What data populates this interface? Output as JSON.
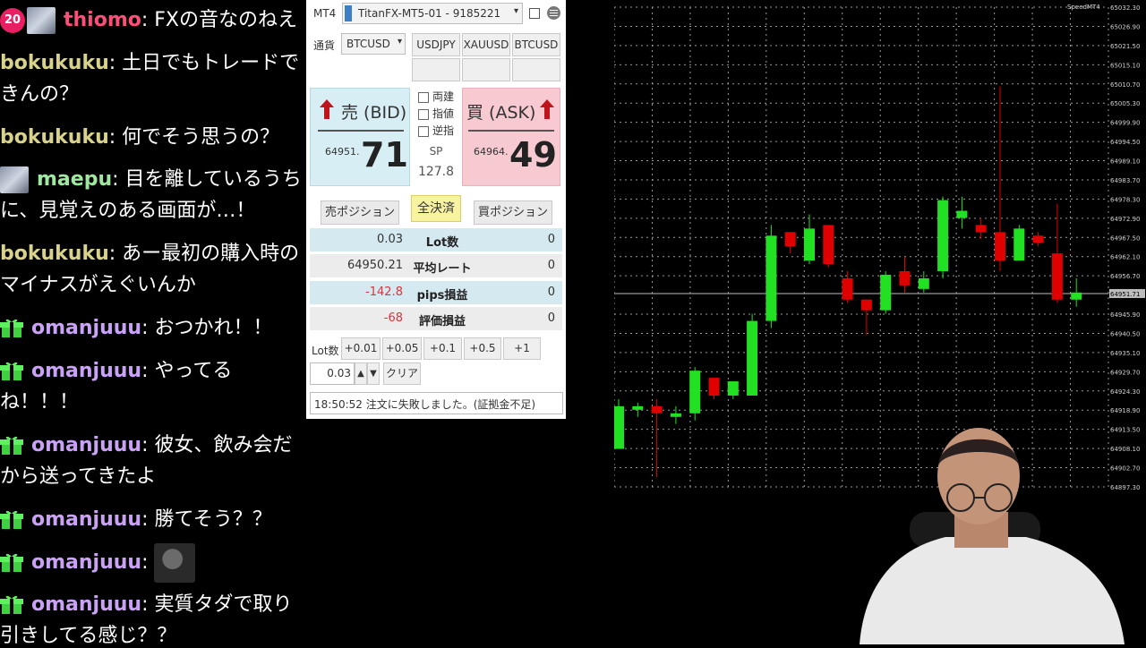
{
  "chat": {
    "messages": [
      {
        "badge": "sub",
        "badge_text": "20",
        "avatar": true,
        "user": "thiomo",
        "user_color": "#ff4d7a",
        "text": "FXの音なのねえ"
      },
      {
        "user": "bokukuku",
        "user_color": "#d8d28a",
        "text": "土日でもトレードできんの？"
      },
      {
        "user": "bokukuku",
        "user_color": "#d8d28a",
        "text": "何でそう思うの？"
      },
      {
        "avatar": true,
        "user": "maepu",
        "user_color": "#9ee8a0",
        "text": "目を離しているうちに、見覚えのある画面が…！"
      },
      {
        "user": "bokukuku",
        "user_color": "#d8d28a",
        "text": "あー最初の購入時のマイナスがえぐいんか"
      },
      {
        "badge": "gift",
        "user": "omanjuuu",
        "user_color": "#c9a2f5",
        "text": "おつかれ！！"
      },
      {
        "badge": "gift",
        "user": "omanjuuu",
        "user_color": "#c9a2f5",
        "text": "やってるね！！！"
      },
      {
        "badge": "gift",
        "user": "omanjuuu",
        "user_color": "#c9a2f5",
        "text": "彼女、飲み会だから送ってきたよ"
      },
      {
        "badge": "gift",
        "user": "omanjuuu",
        "user_color": "#c9a2f5",
        "text": "勝てそう？？"
      },
      {
        "badge": "gift",
        "user": "omanjuuu",
        "user_color": "#c9a2f5",
        "text": "",
        "emote": true
      },
      {
        "badge": "gift",
        "user": "omanjuuu",
        "user_color": "#c9a2f5",
        "text": "実質タダで取り引きしてる感じ？？"
      }
    ]
  },
  "panel": {
    "platform_label": "MT4",
    "account": "TitanFX-MT5-01 - 9185221",
    "currency_label": "通貨",
    "symbol": "BTCUSD",
    "quick_symbols": [
      "USDJPY",
      "XAUUSD",
      "BTCUSD"
    ],
    "bid_label": "売 (BID)",
    "bid_prefix": "64951.",
    "bid_big": "71",
    "ask_label": "買 (ASK)",
    "ask_prefix": "64964.",
    "ask_big": "49",
    "checkboxes": [
      "両建",
      "指値",
      "逆指"
    ],
    "sp_label": "SP",
    "sp_value": "127.8",
    "sell_position": "売ポジション",
    "close_all": "全決済",
    "buy_position": "買ポジション",
    "rows": [
      {
        "left": "0.03",
        "label": "Lot数",
        "right": "0",
        "left_color": "#333"
      },
      {
        "left": "64950.21",
        "label": "平均レート",
        "right": "0",
        "left_color": "#333"
      },
      {
        "left": "-142.8",
        "label": "pips損益",
        "right": "0",
        "left_color": "#e0303a"
      },
      {
        "left": "-68",
        "label": "評価損益",
        "right": "0",
        "left_color": "#e0303a"
      }
    ],
    "lot_label": "Lot数",
    "lot_buttons": [
      "+0.01",
      "+0.05",
      "+0.1",
      "+0.5",
      "+1"
    ],
    "lot_value": "0.03",
    "clear_label": "クリア",
    "status": "18:50:52 注文に失敗しました。(証拠金不足)"
  },
  "chart_data": {
    "type": "candlestick",
    "title": "SpeedMT4",
    "ylim": [
      64897.3,
      65032.3
    ],
    "y_ticks": [
      "65032.30",
      "65026.90",
      "65021.50",
      "65015.10",
      "65010.70",
      "65005.30",
      "64999.90",
      "64994.50",
      "64989.10",
      "64983.70",
      "64978.30",
      "64972.90",
      "64967.50",
      "64962.10",
      "64956.70",
      "64951.71",
      "64945.90",
      "64940.50",
      "64935.10",
      "64929.70",
      "64924.30",
      "64918.90",
      "64913.50",
      "64908.10",
      "64902.70",
      "64897.30"
    ],
    "current_price": "64951.71",
    "candles": [
      {
        "o": 64908,
        "h": 64922,
        "l": 64908,
        "c": 64920
      },
      {
        "o": 64919,
        "h": 64921,
        "l": 64917,
        "c": 64920
      },
      {
        "o": 64920,
        "h": 64922,
        "l": 64900,
        "c": 64918
      },
      {
        "o": 64917,
        "h": 64920,
        "l": 64915,
        "c": 64918
      },
      {
        "o": 64918,
        "h": 64931,
        "l": 64916,
        "c": 64930
      },
      {
        "o": 64928,
        "h": 64928,
        "l": 64922,
        "c": 64923
      },
      {
        "o": 64923,
        "h": 64927,
        "l": 64922,
        "c": 64927
      },
      {
        "o": 64923,
        "h": 64946,
        "l": 64923,
        "c": 64944
      },
      {
        "o": 64944,
        "h": 64971,
        "l": 64942,
        "c": 64968
      },
      {
        "o": 64969,
        "h": 64969,
        "l": 64963,
        "c": 64965
      },
      {
        "o": 64961,
        "h": 64974,
        "l": 64960,
        "c": 64970
      },
      {
        "o": 64971,
        "h": 64971,
        "l": 64959,
        "c": 64960
      },
      {
        "o": 64956,
        "h": 64958,
        "l": 64949,
        "c": 64950
      },
      {
        "o": 64950,
        "h": 64950,
        "l": 64940,
        "c": 64947
      },
      {
        "o": 64947,
        "h": 64958,
        "l": 64946,
        "c": 64957
      },
      {
        "o": 64958,
        "h": 64962,
        "l": 64952,
        "c": 64954
      },
      {
        "o": 64953,
        "h": 64958,
        "l": 64952,
        "c": 64956
      },
      {
        "o": 64958,
        "h": 64979,
        "l": 64956,
        "c": 64978
      },
      {
        "o": 64973,
        "h": 64979,
        "l": 64970,
        "c": 64975
      },
      {
        "o": 64971,
        "h": 64973,
        "l": 64967,
        "c": 64969
      },
      {
        "o": 64969,
        "h": 65010,
        "l": 64958,
        "c": 64961
      },
      {
        "o": 64961,
        "h": 64971,
        "l": 64961,
        "c": 64970
      },
      {
        "o": 64968,
        "h": 64969,
        "l": 64965,
        "c": 64966
      },
      {
        "o": 64963,
        "h": 64977,
        "l": 64949,
        "c": 64950
      },
      {
        "o": 64950,
        "h": 64956,
        "l": 64948,
        "c": 64952
      }
    ]
  },
  "colors": {
    "bull": "#22e022",
    "bear": "#e00000",
    "grid": "#9a9a9a"
  }
}
